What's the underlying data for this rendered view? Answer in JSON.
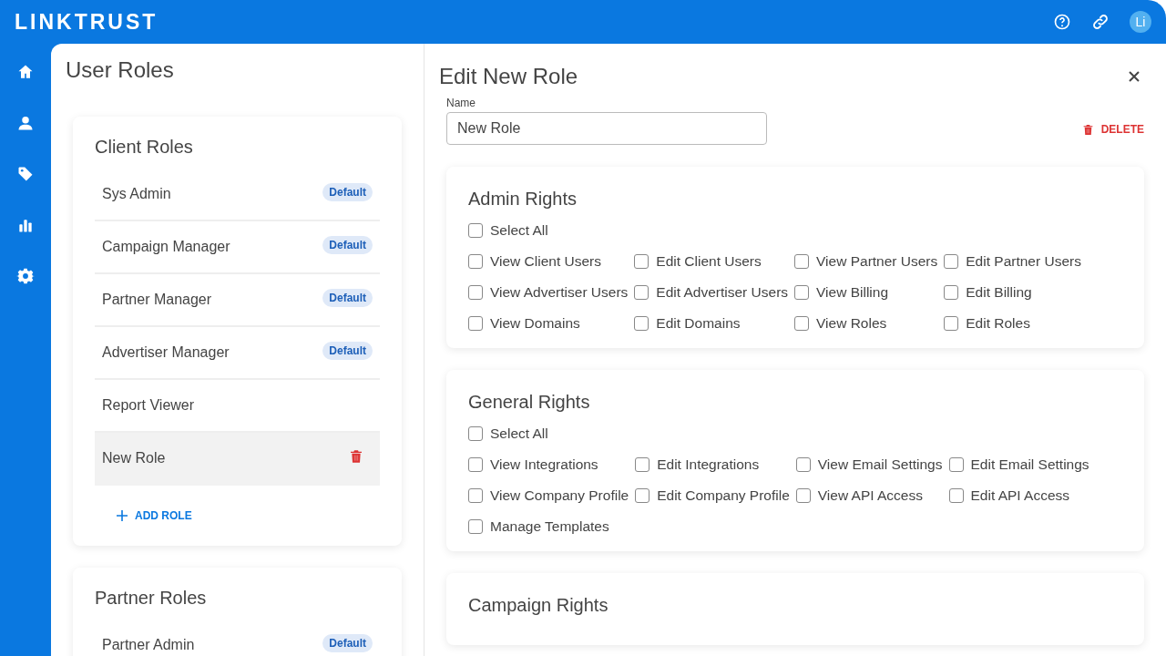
{
  "header": {
    "logo": "LINKTRUST",
    "avatar": "Li"
  },
  "nav": [
    {
      "kind": "home",
      "selected": false
    },
    {
      "kind": "user",
      "selected": false
    },
    {
      "kind": "tag",
      "selected": false
    },
    {
      "kind": "chart",
      "selected": false
    },
    {
      "kind": "gear",
      "selected": false
    }
  ],
  "roles_panel": {
    "title": "User Roles",
    "groups": [
      {
        "title": "Client Roles",
        "roles": [
          {
            "name": "Sys Admin",
            "badge": "Default",
            "selected": false
          },
          {
            "name": "Campaign Manager",
            "badge": "Default",
            "selected": false
          },
          {
            "name": "Partner Manager",
            "badge": "Default",
            "selected": false
          },
          {
            "name": "Advertiser Manager",
            "badge": "Default",
            "selected": false
          },
          {
            "name": "Report Viewer",
            "selected": false
          },
          {
            "name": "New Role",
            "selected": true
          }
        ],
        "add_label": "ADD ROLE"
      },
      {
        "title": "Partner Roles",
        "roles": [
          {
            "name": "Partner Admin",
            "badge": "Default",
            "selected": false
          }
        ]
      }
    ]
  },
  "editor": {
    "title": "Edit New Role",
    "name_label": "Name",
    "name_value": "New Role",
    "delete_label": "DELETE",
    "sections": [
      {
        "title": "Admin Rights",
        "select_all": {
          "label": "Select All",
          "checked": false
        },
        "rights": [
          {
            "label": "View Client Users",
            "checked": false
          },
          {
            "label": "Edit Client Users",
            "checked": false
          },
          {
            "label": "View Partner Users",
            "checked": false
          },
          {
            "label": "Edit Partner Users",
            "checked": false
          },
          {
            "label": "View Advertiser Users",
            "checked": false
          },
          {
            "label": "Edit Advertiser Users",
            "checked": false
          },
          {
            "label": "View Billing",
            "checked": false
          },
          {
            "label": "Edit Billing",
            "checked": false
          },
          {
            "label": "View Domains",
            "checked": false
          },
          {
            "label": "Edit Domains",
            "checked": false
          },
          {
            "label": "View Roles",
            "checked": false
          },
          {
            "label": "Edit Roles",
            "checked": false
          }
        ]
      },
      {
        "title": "General Rights",
        "select_all": {
          "label": "Select All",
          "checked": false
        },
        "rights": [
          {
            "label": "View Integrations",
            "checked": false
          },
          {
            "label": "Edit Integrations",
            "checked": false
          },
          {
            "label": "View Email Settings",
            "checked": false
          },
          {
            "label": "Edit Email Settings",
            "checked": false
          },
          {
            "label": "View Company Profile",
            "checked": false
          },
          {
            "label": "Edit Company Profile",
            "checked": false
          },
          {
            "label": "View API Access",
            "checked": false
          },
          {
            "label": "Edit API Access",
            "checked": false
          },
          {
            "label": "Manage Templates",
            "checked": false
          }
        ]
      },
      {
        "title": "Campaign Rights"
      }
    ]
  }
}
